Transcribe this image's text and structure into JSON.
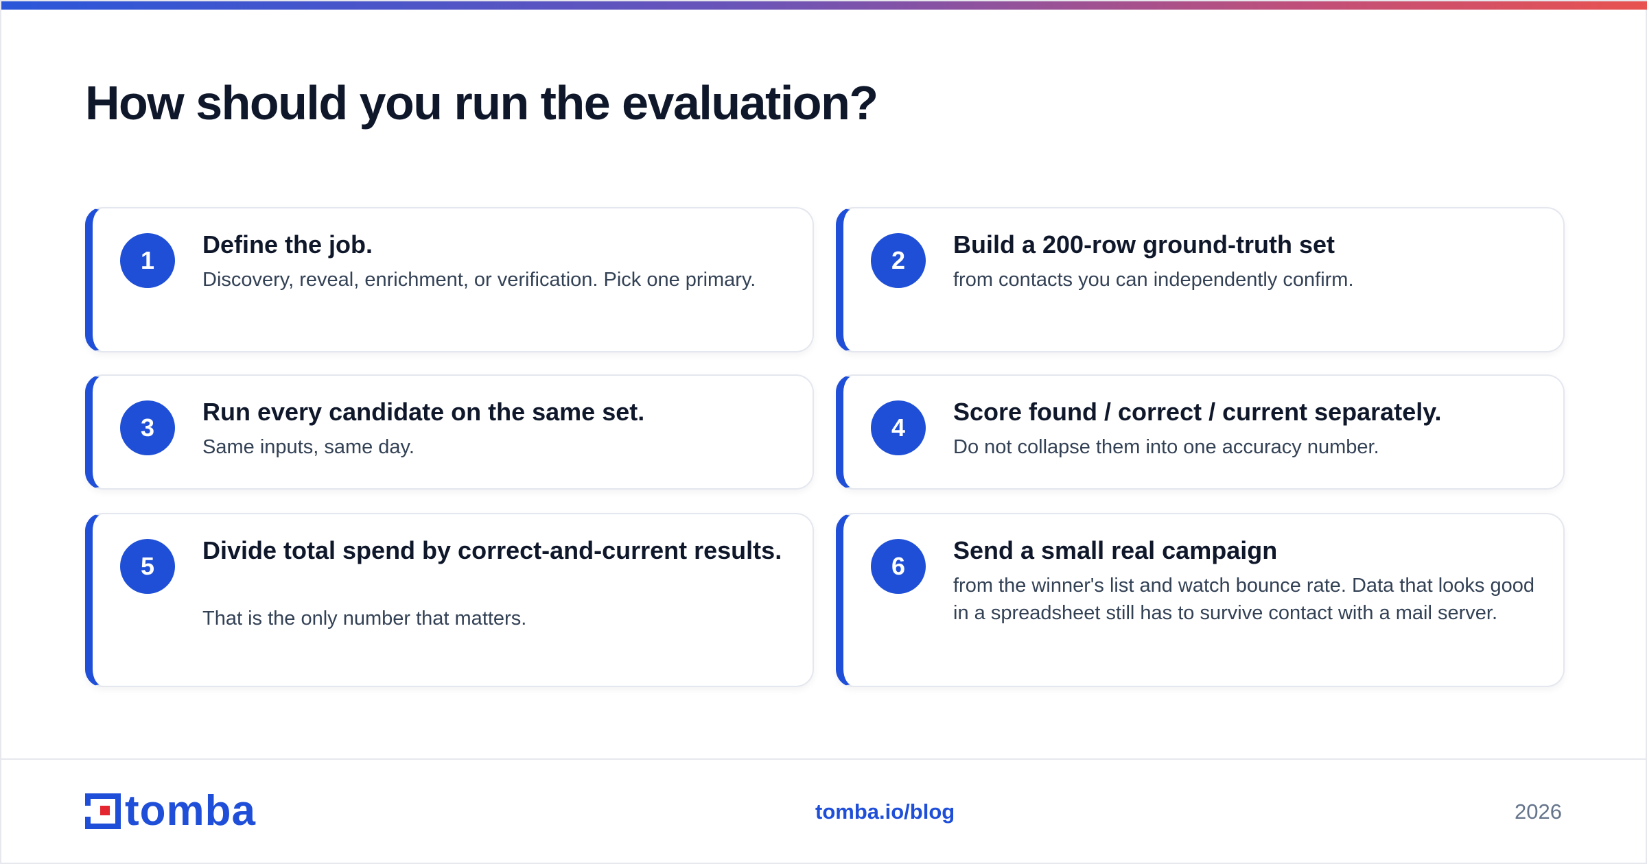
{
  "header": {
    "accent_gradient": [
      "#2a56d9",
      "#6a54b8",
      "#c24f78",
      "#e8524f"
    ],
    "title": "How should you run the evaluation?"
  },
  "steps": [
    {
      "number": "1",
      "title": "Define the job.",
      "body": "Discovery, reveal, enrichment, or verification. Pick one primary."
    },
    {
      "number": "2",
      "title": "Build a 200-row ground-truth set",
      "body": "from contacts you can independently confirm."
    },
    {
      "number": "3",
      "title": "Run every candidate on the same set.",
      "body": "Same inputs, same day."
    },
    {
      "number": "4",
      "title": "Score found / correct / current separately.",
      "body": "Do not collapse them into one accuracy number."
    },
    {
      "number": "5",
      "title": "Divide total spend by correct-and-current results.",
      "body": "That is the only number that matters."
    },
    {
      "number": "6",
      "title": "Send a small real campaign",
      "body": "from the winner's list and watch bounce rate. Data that looks good in a spreadsheet still has to survive contact with a mail server."
    }
  ],
  "colors": {
    "accent": "#1f4fd8",
    "title": "#0f172a",
    "body": "#334155",
    "muted": "#64748b",
    "logo_red": "#e3262f"
  },
  "footer": {
    "logo_icon": "tomba-logo-icon",
    "logo_text": "tomba",
    "link": "tomba.io/blog",
    "year": "2026"
  }
}
